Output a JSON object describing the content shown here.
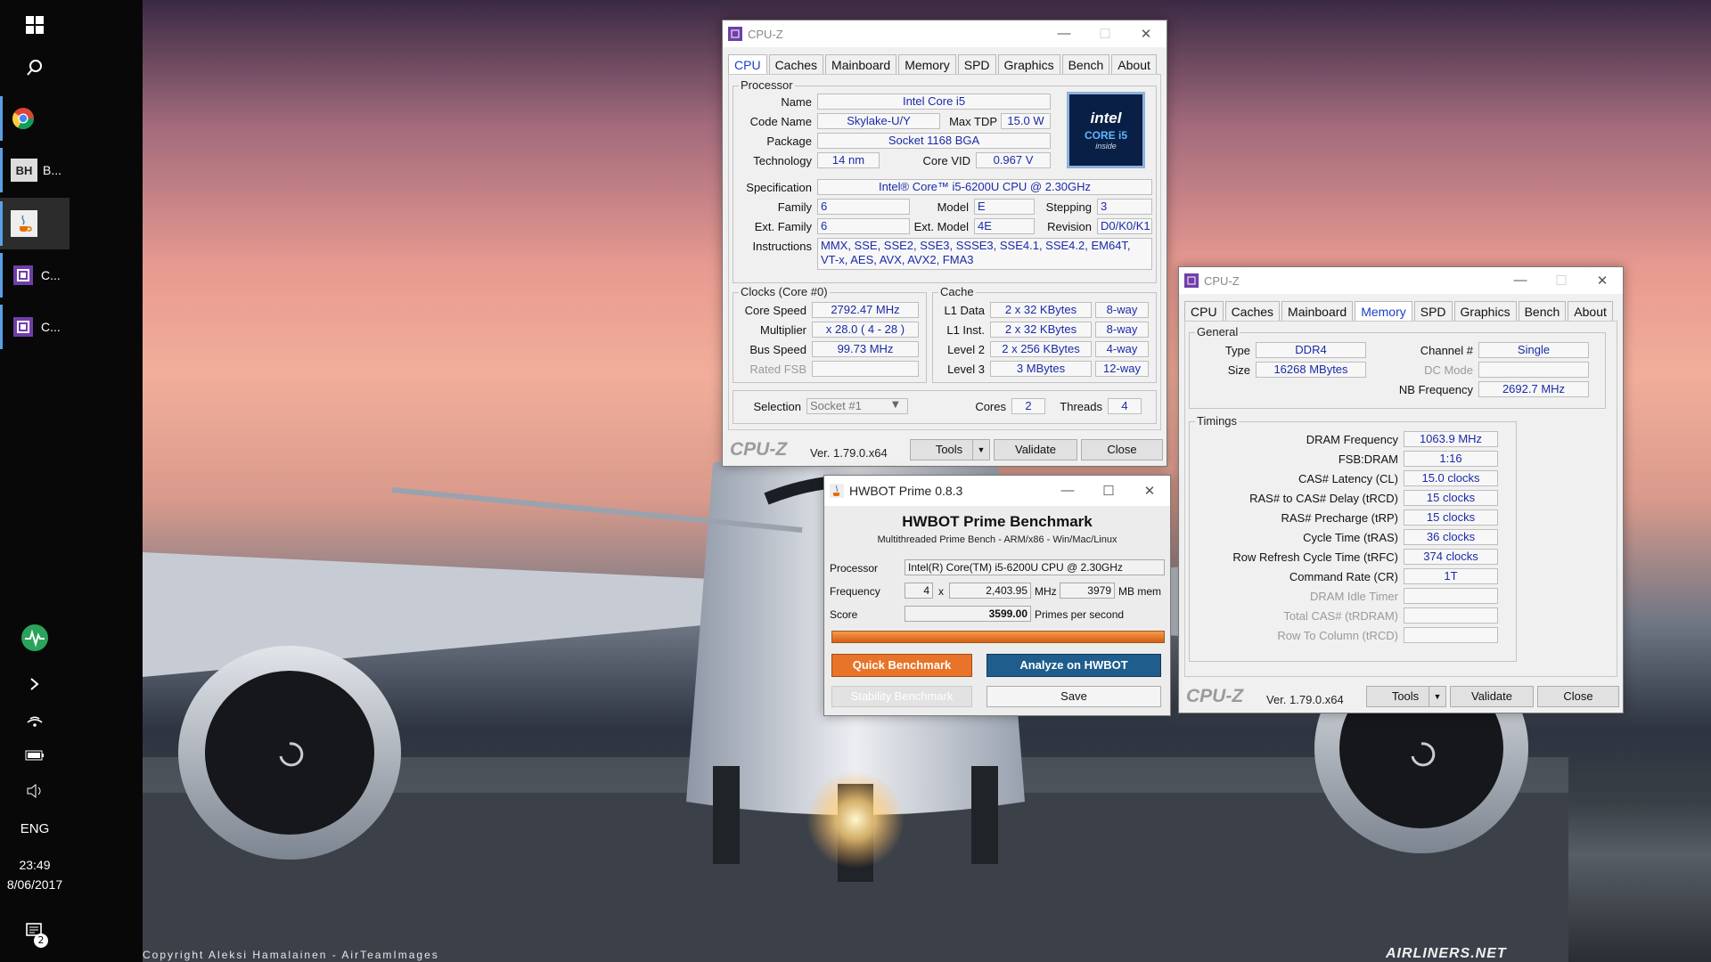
{
  "taskbar": {
    "apps": [
      {
        "label": "B..."
      },
      {
        "label": ""
      },
      {
        "label": "C..."
      },
      {
        "label": "C..."
      }
    ],
    "language": "ENG",
    "time": "23:49",
    "date": "8/06/2017",
    "notifications_count": "2"
  },
  "wallpaper": {
    "credit": "Copyright Aleksi Hamalainen - AirTeamImages",
    "watermark": "AIRLINERS.NET"
  },
  "cpuz_main": {
    "title": "CPU-Z",
    "tabs": [
      "CPU",
      "Caches",
      "Mainboard",
      "Memory",
      "SPD",
      "Graphics",
      "Bench",
      "About"
    ],
    "selected_tab": "CPU",
    "processor": {
      "group_label": "Processor",
      "name_label": "Name",
      "name": "Intel Core i5",
      "codename_label": "Code Name",
      "codename": "Skylake-U/Y",
      "maxtdp_label": "Max TDP",
      "maxtdp": "15.0 W",
      "package_label": "Package",
      "package": "Socket 1168 BGA",
      "technology_label": "Technology",
      "technology": "14 nm",
      "corevid_label": "Core VID",
      "corevid": "0.967 V",
      "spec_label": "Specification",
      "spec": "Intel® Core™ i5-6200U CPU @ 2.30GHz",
      "family_label": "Family",
      "family": "6",
      "model_label": "Model",
      "model": "E",
      "stepping_label": "Stepping",
      "stepping": "3",
      "extfamily_label": "Ext. Family",
      "extfamily": "6",
      "extmodel_label": "Ext. Model",
      "extmodel": "4E",
      "revision_label": "Revision",
      "revision": "D0/K0/K1",
      "instructions_label": "Instructions",
      "instructions": "MMX, SSE, SSE2, SSE3, SSSE3, SSE4.1, SSE4.2, EM64T, VT-x, AES, AVX, AVX2, FMA3",
      "logo_text_top": "intel",
      "logo_text_mid": "CORE i5",
      "logo_text_bot": "inside"
    },
    "clocks": {
      "group_label": "Clocks (Core #0)",
      "corespeed_label": "Core Speed",
      "corespeed": "2792.47 MHz",
      "multiplier_label": "Multiplier",
      "multiplier": "x 28.0 ( 4 - 28 )",
      "busspeed_label": "Bus Speed",
      "busspeed": "99.73 MHz",
      "ratedfsb_label": "Rated FSB",
      "ratedfsb": ""
    },
    "cache": {
      "group_label": "Cache",
      "l1d_label": "L1 Data",
      "l1d": "2 x 32 KBytes",
      "l1d_way": "8-way",
      "l1i_label": "L1 Inst.",
      "l1i": "2 x 32 KBytes",
      "l1i_way": "8-way",
      "l2_label": "Level 2",
      "l2": "2 x 256 KBytes",
      "l2_way": "4-way",
      "l3_label": "Level 3",
      "l3": "3 MBytes",
      "l3_way": "12-way"
    },
    "selection_label": "Selection",
    "selection": "Socket #1",
    "cores_label": "Cores",
    "cores": "2",
    "threads_label": "Threads",
    "threads": "4",
    "brand": "CPU-Z",
    "version": "Ver. 1.79.0.x64",
    "tools": "Tools",
    "validate": "Validate",
    "close": "Close"
  },
  "cpuz_mem": {
    "title": "CPU-Z",
    "tabs": [
      "CPU",
      "Caches",
      "Mainboard",
      "Memory",
      "SPD",
      "Graphics",
      "Bench",
      "About"
    ],
    "selected_tab": "Memory",
    "general": {
      "group_label": "General",
      "type_label": "Type",
      "type": "DDR4",
      "size_label": "Size",
      "size": "16268 MBytes",
      "channel_label": "Channel #",
      "channel": "Single",
      "dcmode_label": "DC Mode",
      "dcmode": "",
      "nbfreq_label": "NB Frequency",
      "nbfreq": "2692.7 MHz"
    },
    "timings": {
      "group_label": "Timings",
      "rows": [
        {
          "label": "DRAM Frequency",
          "value": "1063.9 MHz",
          "dim": false
        },
        {
          "label": "FSB:DRAM",
          "value": "1:16",
          "dim": false
        },
        {
          "label": "CAS# Latency (CL)",
          "value": "15.0 clocks",
          "dim": false
        },
        {
          "label": "RAS# to CAS# Delay (tRCD)",
          "value": "15 clocks",
          "dim": false
        },
        {
          "label": "RAS# Precharge (tRP)",
          "value": "15 clocks",
          "dim": false
        },
        {
          "label": "Cycle Time (tRAS)",
          "value": "36 clocks",
          "dim": false
        },
        {
          "label": "Row Refresh Cycle Time (tRFC)",
          "value": "374 clocks",
          "dim": false
        },
        {
          "label": "Command Rate (CR)",
          "value": "1T",
          "dim": false
        },
        {
          "label": "DRAM Idle Timer",
          "value": "",
          "dim": true
        },
        {
          "label": "Total CAS# (tRDRAM)",
          "value": "",
          "dim": true
        },
        {
          "label": "Row To Column (tRCD)",
          "value": "",
          "dim": true
        }
      ]
    },
    "brand": "CPU-Z",
    "version": "Ver. 1.79.0.x64",
    "tools": "Tools",
    "validate": "Validate",
    "close": "Close"
  },
  "hwbot": {
    "title": "HWBOT Prime 0.8.3",
    "heading": "HWBOT Prime Benchmark",
    "subheading": "Multithreaded Prime Bench - ARM/x86 - Win/Mac/Linux",
    "processor_label": "Processor",
    "processor": "Intel(R) Core(TM) i5-6200U CPU @ 2.30GHz",
    "frequency_label": "Frequency",
    "threads": "4",
    "x_label": "x",
    "frequency": "2,403.95",
    "mhz_label": "MHz",
    "mem": "3979",
    "mem_label": "MB mem",
    "score_label": "Score",
    "score": "3599.00",
    "score_unit": "Primes per second",
    "progress": 1.0,
    "quick_bench": "Quick Benchmark",
    "analyze": "Analyze on HWBOT",
    "stability_bench": "Stability Benchmark",
    "save": "Save"
  },
  "colors": {
    "accent_orange": "#e8742a",
    "accent_blue": "#1f5e8c",
    "cpuz_value_text": "#1b2aa8",
    "tab_selected_text": "#1a3ec8"
  }
}
